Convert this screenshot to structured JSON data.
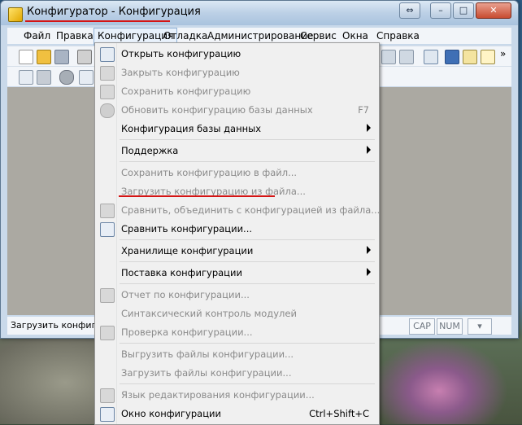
{
  "window": {
    "title": "Конфигуратор - Конфигурация",
    "buttons": {
      "restore": "⇔",
      "minimize": "–",
      "maximize": "□",
      "close": "✕"
    }
  },
  "menubar": [
    "Файл",
    "Правка",
    "Конфигурация",
    "Отладка",
    "Администрирование",
    "Сервис",
    "Окна",
    "Справка"
  ],
  "menu": {
    "items": [
      {
        "label": "Открыть конфигурацию",
        "enabled": true,
        "icon": "open-config-icon"
      },
      {
        "label": "Закрыть конфигурацию",
        "enabled": false,
        "icon": "close-config-icon"
      },
      {
        "label": "Сохранить конфигурацию",
        "enabled": false,
        "icon": "save-config-icon"
      },
      {
        "label": "Обновить конфигурацию базы данных",
        "enabled": false,
        "icon": "db-update-icon",
        "shortcut": "F7"
      },
      {
        "label": "Конфигурация базы данных",
        "enabled": true,
        "submenu": true
      },
      {
        "label": "Поддержка",
        "enabled": true,
        "submenu": true
      },
      {
        "label": "Сохранить конфигурацию в файл...",
        "enabled": false
      },
      {
        "label": "Загрузить конфигурацию из файла...",
        "enabled": false
      },
      {
        "label": "Сравнить, объединить с конфигурацией из файла...",
        "enabled": false,
        "icon": "compare-merge-icon"
      },
      {
        "label": "Сравнить конфигурации...",
        "enabled": true,
        "icon": "compare-icon"
      },
      {
        "label": "Хранилище конфигурации",
        "enabled": true,
        "submenu": true
      },
      {
        "label": "Поставка конфигурации",
        "enabled": true,
        "submenu": true
      },
      {
        "label": "Отчет по конфигурации...",
        "enabled": false,
        "icon": "report-icon"
      },
      {
        "label": "Синтаксический контроль модулей",
        "enabled": false
      },
      {
        "label": "Проверка конфигурации...",
        "enabled": false,
        "icon": "check-icon"
      },
      {
        "label": "Выгрузить файлы конфигурации...",
        "enabled": false
      },
      {
        "label": "Загрузить файлы конфигурации...",
        "enabled": false
      },
      {
        "label": "Язык редактирования конфигурации...",
        "enabled": false,
        "icon": "language-icon"
      },
      {
        "label": "Окно конфигурации",
        "enabled": true,
        "icon": "config-window-icon",
        "shortcut": "Ctrl+Shift+C"
      }
    ]
  },
  "statusbar": {
    "text": "Загрузить конфигур",
    "cap": "CAP",
    "num": "NUM"
  },
  "toolbar": {
    "overflow": "»"
  },
  "colors": {
    "highlight_red": "#d41414",
    "disabled_text": "#8a8a8a"
  }
}
